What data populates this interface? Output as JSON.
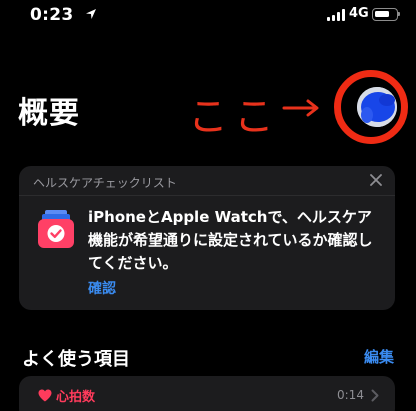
{
  "status_bar": {
    "time": "0:23",
    "network": "4G"
  },
  "header": {
    "title": "概要"
  },
  "annotation": {
    "text": "ここ",
    "color": "#e8321c"
  },
  "checklist_card": {
    "header": "ヘルスケアチェックリスト",
    "body": "iPhoneとApple Watchで、ヘルスケア機能が希望通りに設定されているか確認してください。",
    "link": "確認"
  },
  "favorites": {
    "title": "よく使う項目",
    "edit": "編集",
    "items": [
      {
        "label": "心拍数",
        "time": "0:14",
        "color": "#ff3b5c"
      }
    ]
  },
  "colors": {
    "background": "#000000",
    "card": "#1c1c1e",
    "link": "#3a8bf0"
  }
}
